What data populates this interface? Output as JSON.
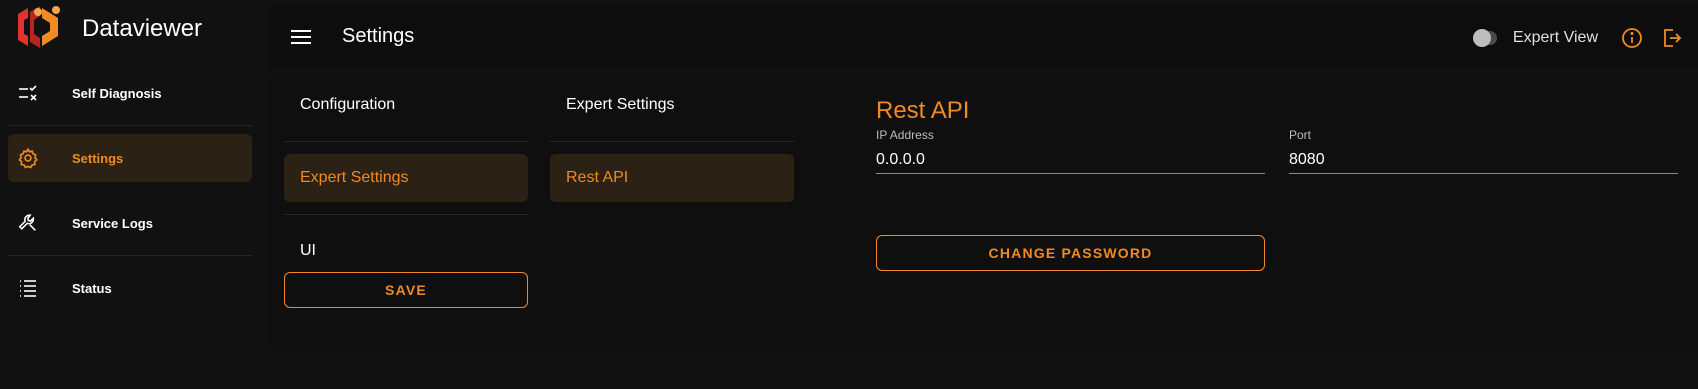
{
  "app": {
    "name": "Dataviewer",
    "accent": "#f08a24",
    "logo_colors": [
      "#e5322d",
      "#f08a24"
    ]
  },
  "sidebar": {
    "items": [
      {
        "label": "Self Diagnosis",
        "icon": "checklist-icon"
      },
      {
        "label": "Settings",
        "icon": "gear-icon",
        "active": true
      },
      {
        "label": "Service Logs",
        "icon": "wrench-icon"
      },
      {
        "label": "Status",
        "icon": "list-icon"
      }
    ]
  },
  "header": {
    "title": "Settings",
    "expert_view_label": "Expert View",
    "expert_view_on": false
  },
  "settings": {
    "categories": [
      {
        "label": "Configuration"
      },
      {
        "label": "Expert Settings",
        "active": true
      },
      {
        "label": "UI"
      }
    ],
    "save_label": "SAVE",
    "expert_header": "Expert Settings",
    "expert_items": [
      {
        "label": "Rest API",
        "active": true
      }
    ],
    "rest_api": {
      "title": "Rest API",
      "ip_label": "IP Address",
      "ip_value": "0.0.0.0",
      "port_label": "Port",
      "port_value": "8080",
      "change_password_label": "CHANGE PASSWORD"
    }
  }
}
